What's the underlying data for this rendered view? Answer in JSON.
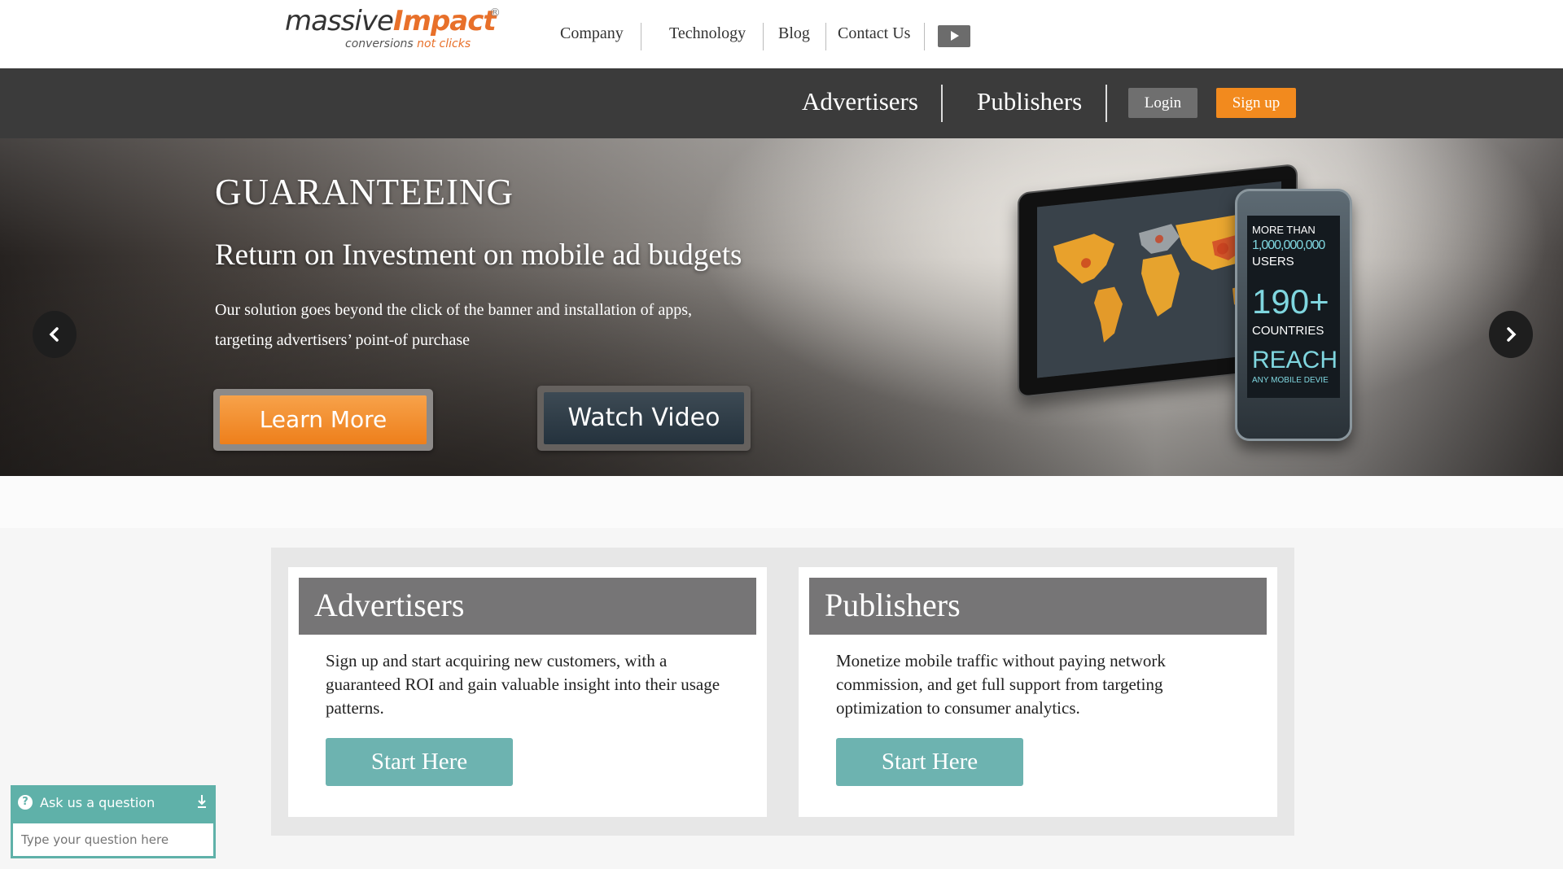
{
  "logo": {
    "word1": "massive",
    "word2": "Impact",
    "tag1": "conversions",
    "tag2": "not clicks",
    "reg": "®"
  },
  "topnav": {
    "items": [
      "Company",
      "Technology",
      "Blog",
      "Contact Us"
    ],
    "video_icon": "play-icon"
  },
  "mainnav": {
    "advertisers": "Advertisers",
    "publishers": "Publishers",
    "login": "Login",
    "signup": "Sign up"
  },
  "hero": {
    "headline": "GUARANTEEING",
    "subheadline": "Return on Investment on mobile ad budgets",
    "description": "Our solution goes beyond the click of the banner and installation of apps, targeting advertisers’ point-of purchase",
    "learn_more": "Learn More",
    "watch_video": "Watch Video",
    "phone": {
      "line1": "MORE THAN",
      "line2": "1,000,000,000",
      "line3": "USERS",
      "line4": "190+",
      "line5": "COUNTRIES",
      "line6": "REACH",
      "line7": "ANY MOBILE DEVIE"
    },
    "prev_icon": "chevron-left-icon",
    "next_icon": "chevron-right-icon"
  },
  "cards": {
    "advertisers": {
      "title": "Advertisers",
      "body": "Sign up and start acquiring new customers, with a guaranteed ROI and gain valuable insight into their usage patterns.",
      "button": "Start Here"
    },
    "publishers": {
      "title": "Publishers",
      "body": "Monetize mobile traffic without paying network commission, and get full support from targeting optimization to consumer analytics.",
      "button": "Start Here"
    }
  },
  "ask": {
    "title": "Ask us a question",
    "placeholder": "Type your question here",
    "icon": "?"
  },
  "colors": {
    "orange": "#f28a1e",
    "teal": "#6db3b0",
    "dark_bar": "#3b3b3b",
    "card_header": "#767576"
  }
}
